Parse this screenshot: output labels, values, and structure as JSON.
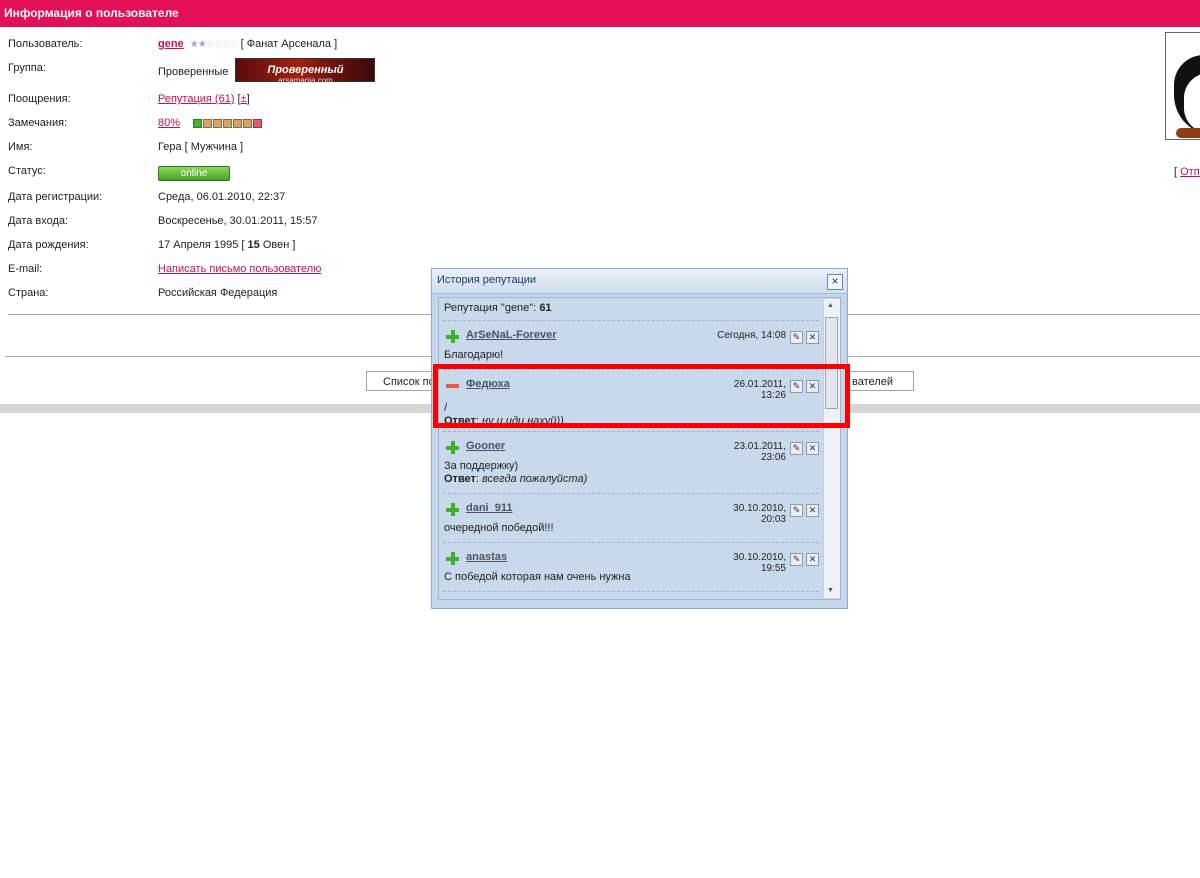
{
  "header": {
    "title": "Информация о пользователе"
  },
  "profile": {
    "user_label": "Пользователь:",
    "username": "gene",
    "user_tag": "[ Фанат Арсенала ]",
    "group_label": "Группа:",
    "group_value": "Проверенные",
    "group_banner_title": "Проверенный",
    "group_banner_site": "arsamania.com",
    "rewards_label": "Поощрения:",
    "reputation_link": "Репутация (61)",
    "reputation_plus": "±",
    "warnings_label": "Замечания:",
    "warnings_pct": "80%",
    "name_label": "Имя:",
    "name_value": "Гера [ Мужчина ]",
    "status_label": "Статус:",
    "status_value": "online",
    "reg_label": "Дата регистрации:",
    "reg_value": "Среда, 06.01.2010, 22:37",
    "login_label": "Дата входа:",
    "login_value": "Воскресенье, 30.01.2011, 15:57",
    "birth_label": "Дата рождения:",
    "birth_value_a": "17 Апреля 1995 [",
    "birth_age": "15",
    "birth_value_b": "Овен ]",
    "email_label": "E-mail:",
    "email_link": "Написать письмо пользователю",
    "country_label": "Страна:",
    "country_value": "Российская Федерация"
  },
  "side": {
    "link_open": "[",
    "link_text": "Отп"
  },
  "buttons": {
    "list_left": "Список по",
    "list_right": "вателей"
  },
  "popup": {
    "title": "История репутации",
    "close": "×",
    "total_label": "Репутация \"gene\": ",
    "total_value": "61",
    "entries": [
      {
        "user": "ArSeNaL-Forever",
        "date": "Сегодня, 14:08",
        "message": "Благодарю!",
        "answer_label": "",
        "answer": "",
        "sign": "plus"
      },
      {
        "user": "Федюха",
        "date": "26.01.2011, 13:26",
        "message": "/",
        "answer_label": "Ответ",
        "answer": "ну и иди нахуй))",
        "sign": "minus"
      },
      {
        "user": "Gooner",
        "date": "23.01.2011, 23:06",
        "message": "За поддержку)",
        "answer_label": "Ответ",
        "answer": "всегда пожалуйста)",
        "sign": "plus"
      },
      {
        "user": "dani_911",
        "date": "30.10.2010, 20:03",
        "message": "очередной победой!!!",
        "answer_label": "",
        "answer": "",
        "sign": "plus"
      },
      {
        "user": "anastas",
        "date": "30.10.2010, 19:55",
        "message": "С победой которая нам очень нужна",
        "answer_label": "",
        "answer": "",
        "sign": "plus"
      }
    ]
  },
  "colors": {
    "accent": "#e30f57",
    "highlight": "#ff0000",
    "popup_bg": "#c5d6ea"
  }
}
